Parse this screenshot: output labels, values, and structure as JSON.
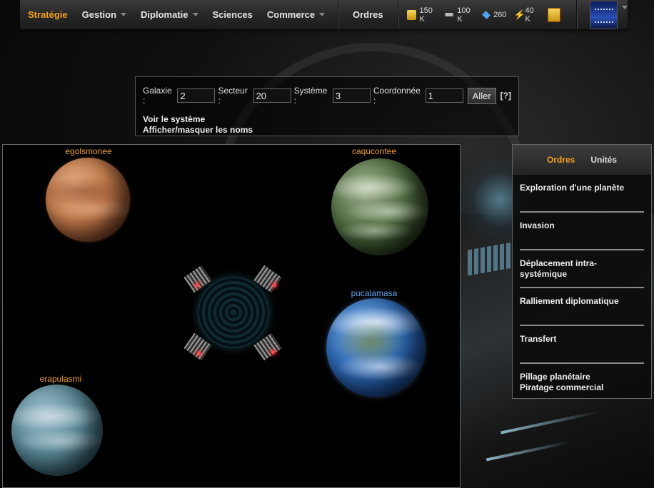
{
  "topbar": {
    "menu": [
      {
        "label": "Stratégie",
        "active": true,
        "dropdown": false
      },
      {
        "label": "Gestion",
        "active": false,
        "dropdown": true
      },
      {
        "label": "Diplomatie",
        "active": false,
        "dropdown": true
      },
      {
        "label": "Sciences",
        "active": false,
        "dropdown": false
      },
      {
        "label": "Commerce",
        "active": false,
        "dropdown": true
      }
    ],
    "orders_label": "Ordres",
    "resources": [
      {
        "icon": "credits-icon",
        "value": "150 K"
      },
      {
        "icon": "ship-icon",
        "value": "100 K"
      },
      {
        "icon": "crystal-icon",
        "value": "260"
      },
      {
        "icon": "energy-icon",
        "value": "40 K"
      }
    ],
    "accent_color": "#f4a21b"
  },
  "coord_form": {
    "galaxy_label": "Galaxie :",
    "galaxy_value": "2",
    "sector_label": "Secteur :",
    "sector_value": "20",
    "system_label": "Système :",
    "system_value": "3",
    "coord_label": "Coordonnée :",
    "coord_value": "1",
    "go_button": "Aller",
    "help": "[?]",
    "view_system_link": "Voir le système",
    "toggle_names_link": "Afficher/masquer les noms"
  },
  "map": {
    "planets": [
      {
        "name": "egolsmonee",
        "owned": false
      },
      {
        "name": "caqucontee",
        "owned": false
      },
      {
        "name": "pucalamasa",
        "owned": true
      },
      {
        "name": "erapulasmi",
        "owned": false
      }
    ]
  },
  "orders_panel": {
    "tabs": [
      {
        "label": "Ordres",
        "active": true
      },
      {
        "label": "Unités",
        "active": false
      }
    ],
    "items": [
      {
        "label": "Exploration d'une planète"
      },
      {
        "label": "Invasion"
      },
      {
        "label": "Déplacement intra-systémique"
      },
      {
        "label": "Ralliement diplomatique"
      },
      {
        "label": "Transfert"
      },
      {
        "label": "Pillage planétaire"
      },
      {
        "label": "Piratage commercial"
      }
    ]
  }
}
